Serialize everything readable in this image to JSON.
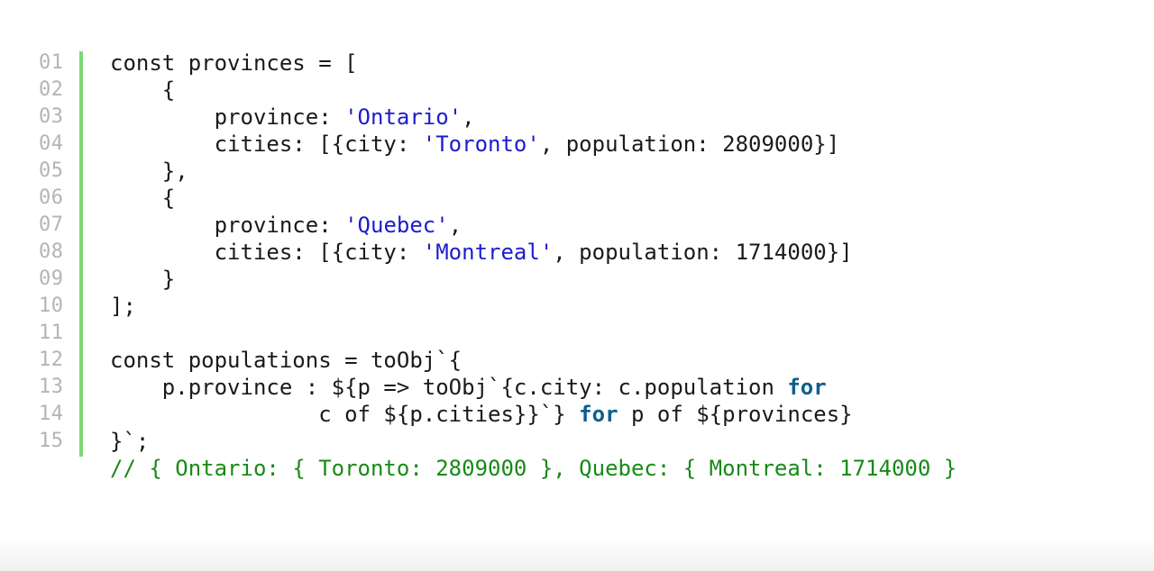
{
  "editor": {
    "accent_bar_color": "#7ed877",
    "colors": {
      "text": "#1a1a1a",
      "string": "#1c1ccf",
      "keyword": "#0e5e8e",
      "comment": "#178a17",
      "line_number": "#b4b4b4"
    },
    "lines": [
      {
        "num": "01",
        "tokens": [
          {
            "t": "const provinces = [",
            "k": "plain"
          }
        ]
      },
      {
        "num": "02",
        "tokens": [
          {
            "t": "    {",
            "k": "plain"
          }
        ]
      },
      {
        "num": "03",
        "tokens": [
          {
            "t": "        province: ",
            "k": "plain"
          },
          {
            "t": "'Ontario'",
            "k": "str"
          },
          {
            "t": ",",
            "k": "plain"
          }
        ]
      },
      {
        "num": "04",
        "tokens": [
          {
            "t": "        cities: [{city: ",
            "k": "plain"
          },
          {
            "t": "'Toronto'",
            "k": "str"
          },
          {
            "t": ", population: 2809000}]",
            "k": "plain"
          }
        ]
      },
      {
        "num": "05",
        "tokens": [
          {
            "t": "    },",
            "k": "plain"
          }
        ]
      },
      {
        "num": "06",
        "tokens": [
          {
            "t": "    {",
            "k": "plain"
          }
        ]
      },
      {
        "num": "07",
        "tokens": [
          {
            "t": "        province: ",
            "k": "plain"
          },
          {
            "t": "'Quebec'",
            "k": "str"
          },
          {
            "t": ",",
            "k": "plain"
          }
        ]
      },
      {
        "num": "08",
        "tokens": [
          {
            "t": "        cities: [{city: ",
            "k": "plain"
          },
          {
            "t": "'Montreal'",
            "k": "str"
          },
          {
            "t": ", population: 1714000}]",
            "k": "plain"
          }
        ]
      },
      {
        "num": "09",
        "tokens": [
          {
            "t": "    }",
            "k": "plain"
          }
        ]
      },
      {
        "num": "10",
        "tokens": [
          {
            "t": "];",
            "k": "plain"
          }
        ]
      },
      {
        "num": "11",
        "tokens": []
      },
      {
        "num": "12",
        "tokens": [
          {
            "t": "const populations = toObj`{",
            "k": "plain"
          }
        ]
      },
      {
        "num": "13",
        "tokens": [
          {
            "t": "    p.province : ${p => toObj`{c.city: c.population ",
            "k": "plain"
          },
          {
            "t": "for",
            "k": "kw"
          }
        ]
      },
      {
        "num": "14",
        "tokens": [
          {
            "t": "                c of ${p.cities}}`} ",
            "k": "plain"
          },
          {
            "t": "for",
            "k": "kw"
          },
          {
            "t": " p of ${provinces}",
            "k": "plain"
          }
        ]
      },
      {
        "num": "15",
        "tokens": [
          {
            "t": "}`;",
            "k": "plain"
          }
        ]
      },
      {
        "num": "",
        "tokens": [
          {
            "t": "// { Ontario: { Toronto: 2809000 }, Quebec: { Montreal: 1714000 }",
            "k": "cm"
          }
        ]
      }
    ]
  }
}
